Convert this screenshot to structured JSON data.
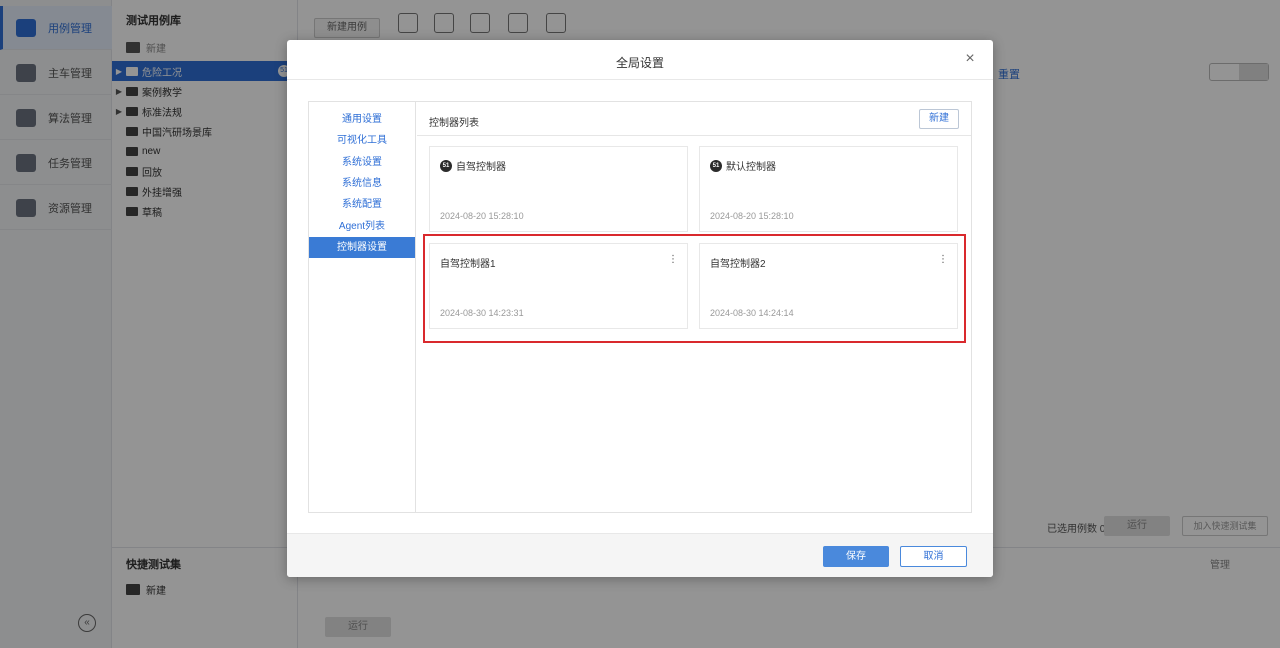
{
  "nav": {
    "items": [
      {
        "label": "用例管理",
        "icon": "folder-icon"
      },
      {
        "label": "主车管理",
        "icon": "car-icon"
      },
      {
        "label": "算法管理",
        "icon": "code-icon"
      },
      {
        "label": "任务管理",
        "icon": "task-check-icon"
      },
      {
        "label": "资源管理",
        "icon": "box-icon"
      }
    ],
    "collapse_label": "«"
  },
  "tree": {
    "title": "测试用例库",
    "new_label": "新建",
    "items": [
      {
        "label": "危险工况",
        "badge": "51"
      },
      {
        "label": "案例教学",
        "badge": ""
      },
      {
        "label": "标准法规",
        "badge": ""
      },
      {
        "label": "中国汽研场景库",
        "badge": ""
      },
      {
        "label": "new",
        "badge": ""
      },
      {
        "label": "回放",
        "badge": ""
      },
      {
        "label": "外挂增强",
        "badge": ""
      },
      {
        "label": "草稿",
        "badge": ""
      }
    ],
    "quick_title": "快捷测试集",
    "quick_new_label": "新建"
  },
  "main": {
    "new_case_label": "新建用例",
    "reset_label": "重置",
    "selected_count_label": "已选用例数 0",
    "run_label": "运行",
    "quick_add_label": "加入快速测试集",
    "manage_label": "管理",
    "bottom_run_label": "运行"
  },
  "modal": {
    "title": "全局设置",
    "close_glyph": "×",
    "menu": [
      "通用设置",
      "可视化工具",
      "系统设置",
      "系统信息",
      "系统配置",
      "Agent列表",
      "控制器设置"
    ],
    "active_menu_index": 6,
    "content_title": "控制器列表",
    "new_button": "新建",
    "cards": [
      {
        "name": "自驾控制器",
        "date": "2024-08-20 15:28:10",
        "logo": "51",
        "menu": false
      },
      {
        "name": "默认控制器",
        "date": "2024-08-20 15:28:10",
        "logo": "51",
        "menu": false
      },
      {
        "name": "自驾控制器1",
        "date": "2024-08-30 14:23:31",
        "logo": "",
        "menu": true
      },
      {
        "name": "自驾控制器2",
        "date": "2024-08-30 14:24:14",
        "logo": "",
        "menu": true
      }
    ],
    "save_label": "保存",
    "cancel_label": "取消"
  },
  "colors": {
    "accent": "#2f6fd6",
    "primary_button": "#4a89dc",
    "highlight": "#d9292d"
  }
}
